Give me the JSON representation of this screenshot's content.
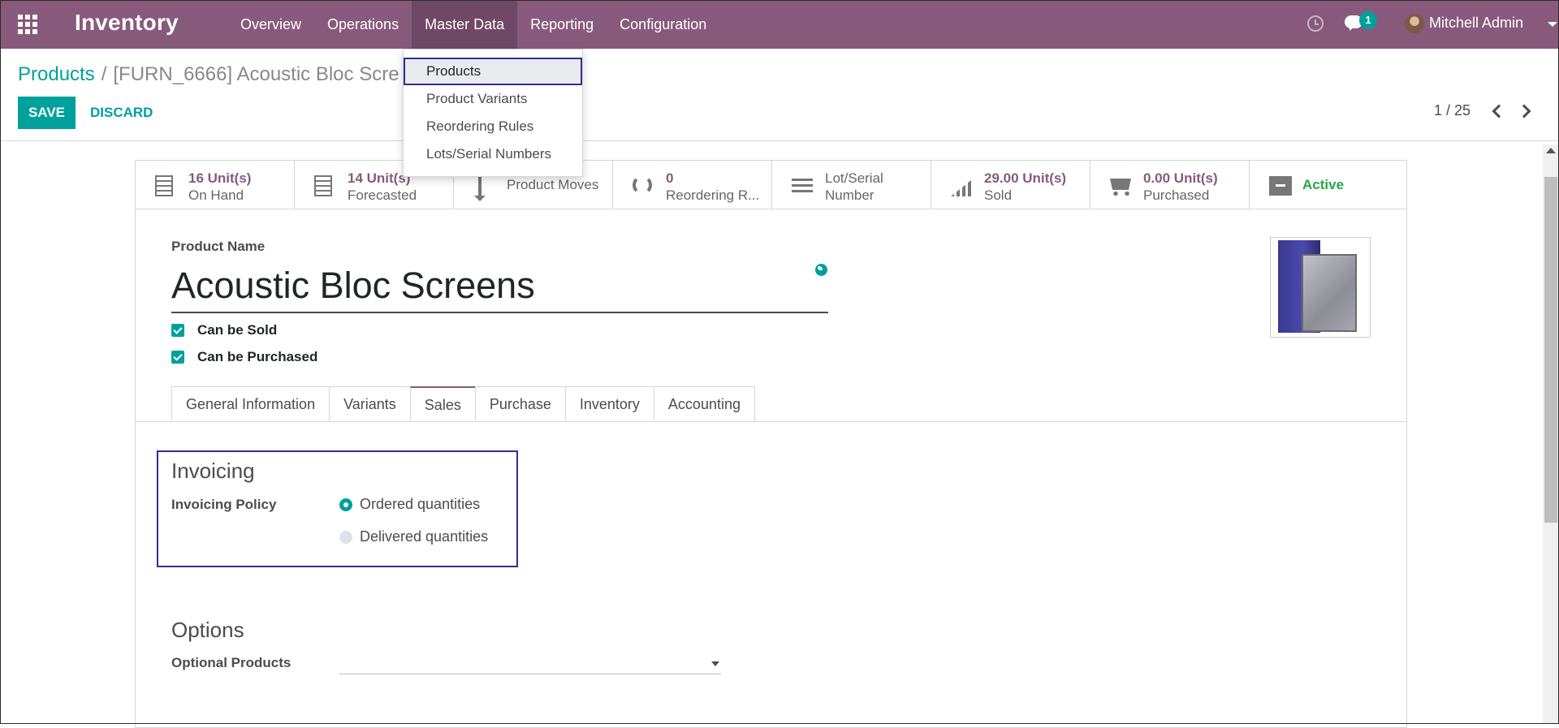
{
  "navbar": {
    "brand": "Inventory",
    "menu": [
      "Overview",
      "Operations",
      "Master Data",
      "Reporting",
      "Configuration"
    ],
    "open_menu": "Master Data",
    "chat_count": "1",
    "user": "Mitchell Admin",
    "colors": {
      "bar": "#875a7b",
      "accent": "#00a09d"
    }
  },
  "dropdown": {
    "items": [
      "Products",
      "Product Variants",
      "Reordering Rules",
      "Lots/Serial Numbers"
    ],
    "highlighted": "Products"
  },
  "breadcrumb": {
    "parent": "Products",
    "separator": "/",
    "current": "[FURN_6666] Acoustic Bloc Scre"
  },
  "actions": {
    "save": "SAVE",
    "discard": "DISCARD"
  },
  "pager": {
    "text": "1 / 25"
  },
  "stat_buttons": [
    {
      "icon": "building-icon",
      "value": "16 Unit(s)",
      "label": "On Hand"
    },
    {
      "icon": "building-icon",
      "value": "14 Unit(s)",
      "label": "Forecasted"
    },
    {
      "icon": "arrows-vertical-icon",
      "label": "Product Moves"
    },
    {
      "icon": "refresh-icon",
      "value": "0",
      "label": "Reordering R..."
    },
    {
      "icon": "list-icon",
      "label": "Lot/Serial",
      "label2": "Number"
    },
    {
      "icon": "signal-icon",
      "value": "29.00 Unit(s)",
      "label": "Sold"
    },
    {
      "icon": "cart-icon",
      "value": "0.00 Unit(s)",
      "label": "Purchased"
    },
    {
      "icon": "archive-icon",
      "label": "Active"
    }
  ],
  "product": {
    "name_label": "Product Name",
    "name": "Acoustic Bloc Screens",
    "can_be_sold": "Can be Sold",
    "can_be_purchased": "Can be Purchased"
  },
  "tabs": [
    "General Information",
    "Variants",
    "Sales",
    "Purchase",
    "Inventory",
    "Accounting"
  ],
  "active_tab": "Sales",
  "invoicing": {
    "title": "Invoicing",
    "policy_label": "Invoicing Policy",
    "options": [
      "Ordered quantities",
      "Delivered quantities"
    ],
    "selected": "Ordered quantities"
  },
  "options_section": {
    "title": "Options",
    "optional_products_label": "Optional Products"
  }
}
